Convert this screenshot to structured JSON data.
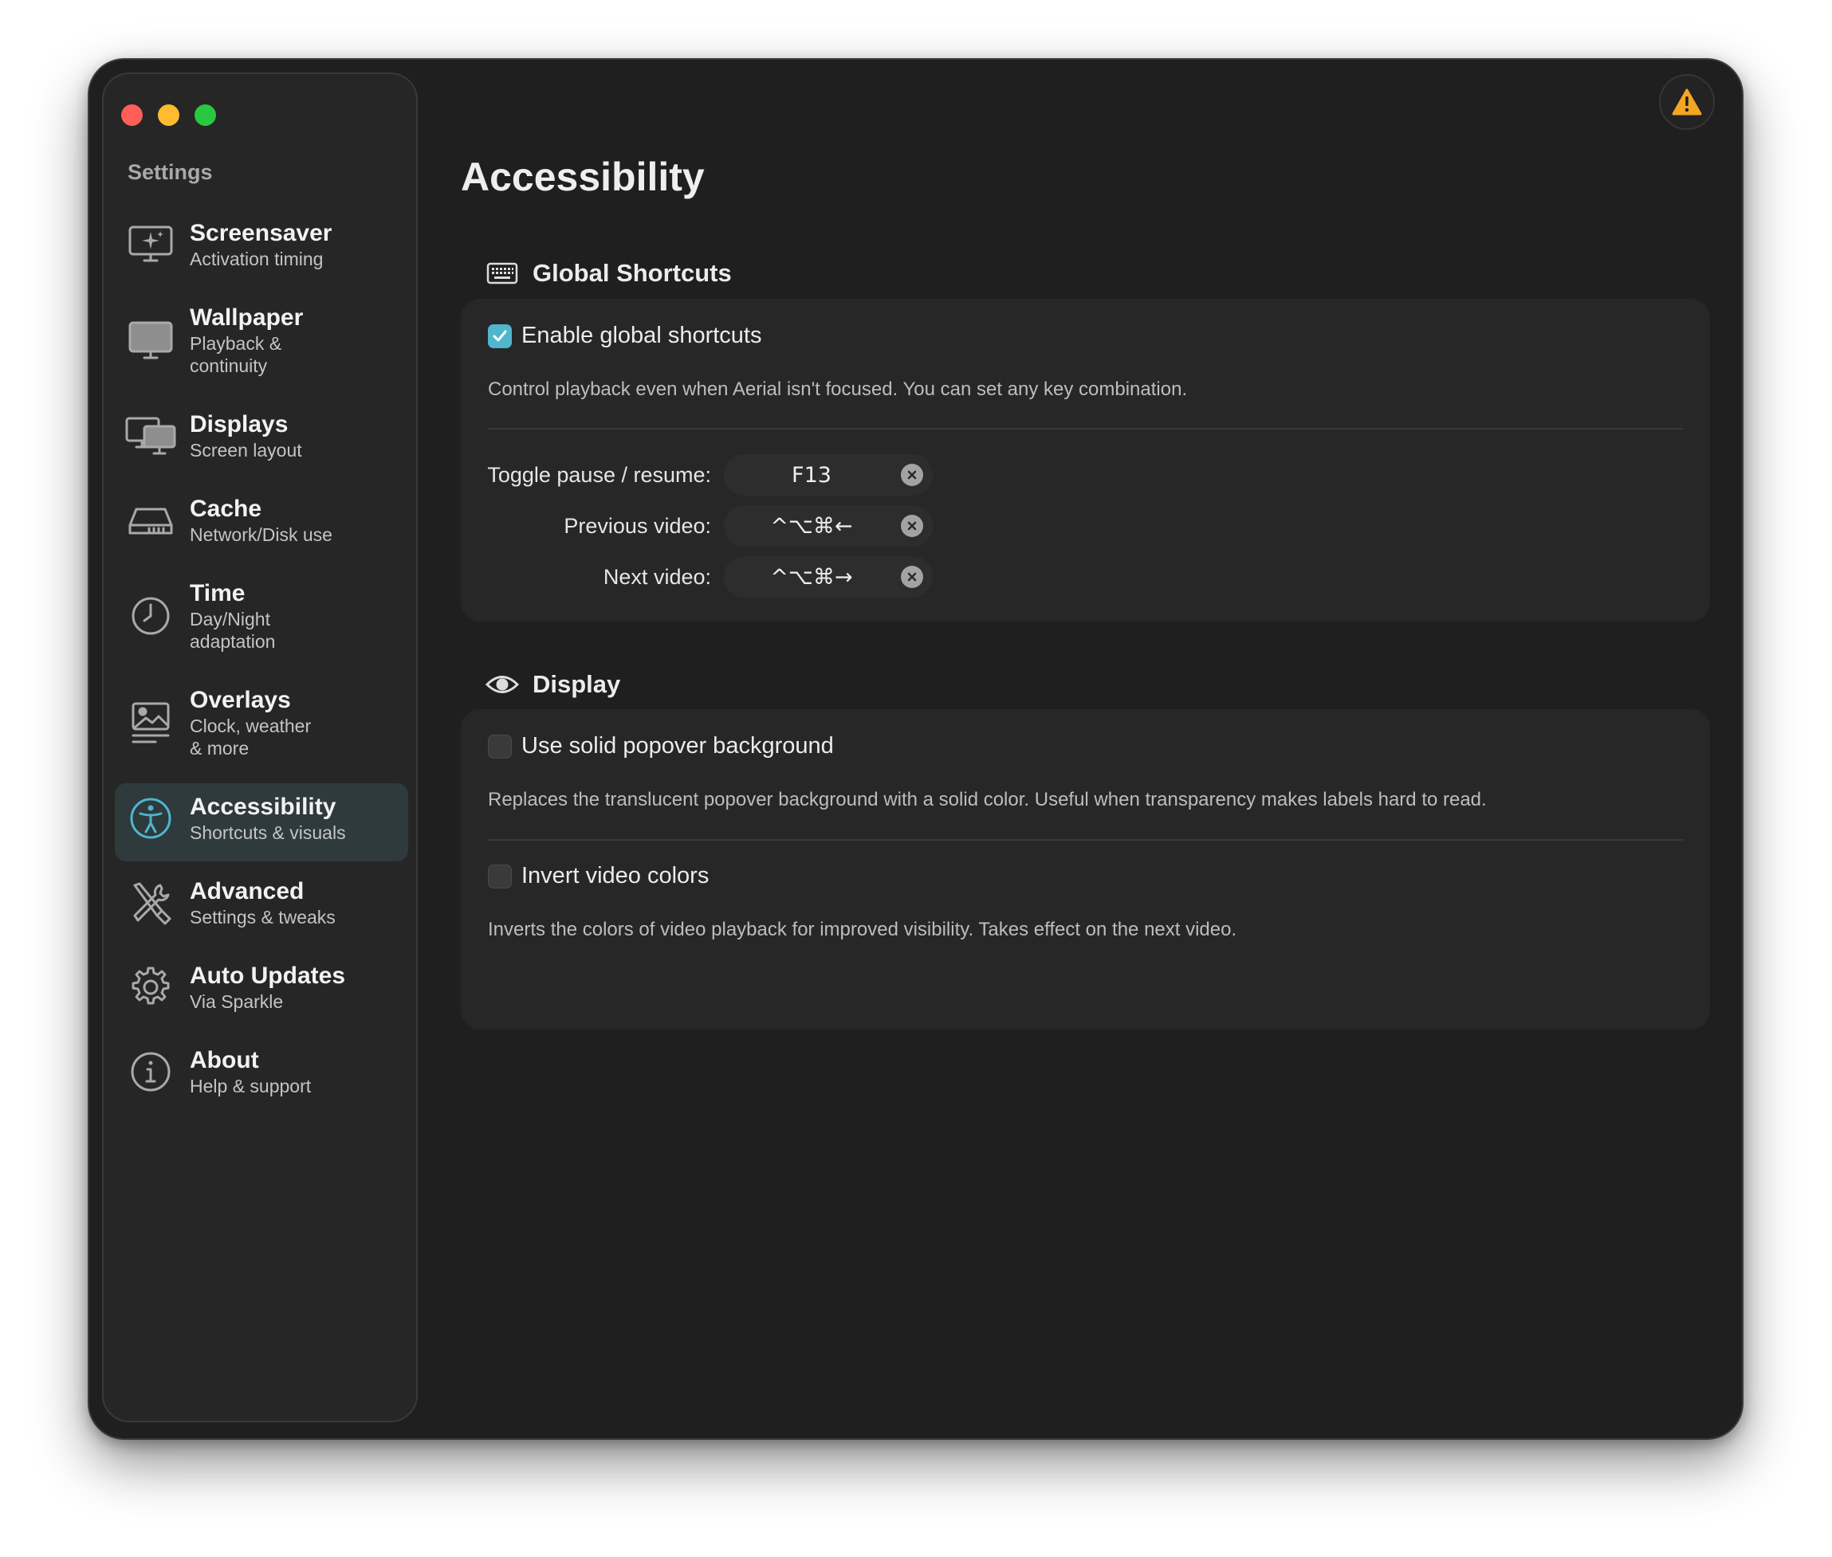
{
  "window": {
    "sidebar": {
      "title": "Settings",
      "items": [
        {
          "label": "Screensaver",
          "sub": "Activation timing",
          "icon": "screensaver-icon",
          "active": false
        },
        {
          "label": "Wallpaper",
          "sub": "Playback &\ncontinuity",
          "icon": "monitor-icon",
          "active": false
        },
        {
          "label": "Displays",
          "sub": "Screen layout",
          "icon": "displays-icon",
          "active": false
        },
        {
          "label": "Cache",
          "sub": "Network/Disk use",
          "icon": "disk-icon",
          "active": false
        },
        {
          "label": "Time",
          "sub": "Day/Night\nadaptation",
          "icon": "clock-icon",
          "active": false
        },
        {
          "label": "Overlays",
          "sub": "Clock, weather\n& more",
          "icon": "overlay-image-icon",
          "active": false
        },
        {
          "label": "Accessibility",
          "sub": "Shortcuts & visuals",
          "icon": "accessibility-icon",
          "active": true
        },
        {
          "label": "Advanced",
          "sub": "Settings & tweaks",
          "icon": "tools-icon",
          "active": false
        },
        {
          "label": "Auto Updates",
          "sub": "Via Sparkle",
          "icon": "gear-icon",
          "active": false
        },
        {
          "label": "About",
          "sub": "Help & support",
          "icon": "info-icon",
          "active": false
        }
      ]
    },
    "warning_icon": "warning-triangle-icon",
    "accent_color": "#4fb6cd",
    "warning_color": "#f5a524"
  },
  "main": {
    "title": "Accessibility",
    "global_shortcuts": {
      "heading": "Global Shortcuts",
      "icon": "keyboard-icon",
      "enable_label": "Enable global shortcuts",
      "enable_checked": true,
      "description": "Control playback even when Aerial isn't focused. You can set any key combination.",
      "shortcuts": [
        {
          "label": "Toggle pause / resume:",
          "value": "F13"
        },
        {
          "label": "Previous video:",
          "value": "^⌥⌘←"
        },
        {
          "label": "Next video:",
          "value": "^⌥⌘→"
        }
      ]
    },
    "display": {
      "heading": "Display",
      "icon": "eye-icon",
      "options": [
        {
          "label": "Use solid popover background",
          "checked": false,
          "description": "Replaces the translucent popover background with a solid color. Useful when transparency makes labels hard to read."
        },
        {
          "label": "Invert video colors",
          "checked": false,
          "description": "Inverts the colors of video playback for improved visibility. Takes effect on the next video."
        }
      ]
    }
  }
}
